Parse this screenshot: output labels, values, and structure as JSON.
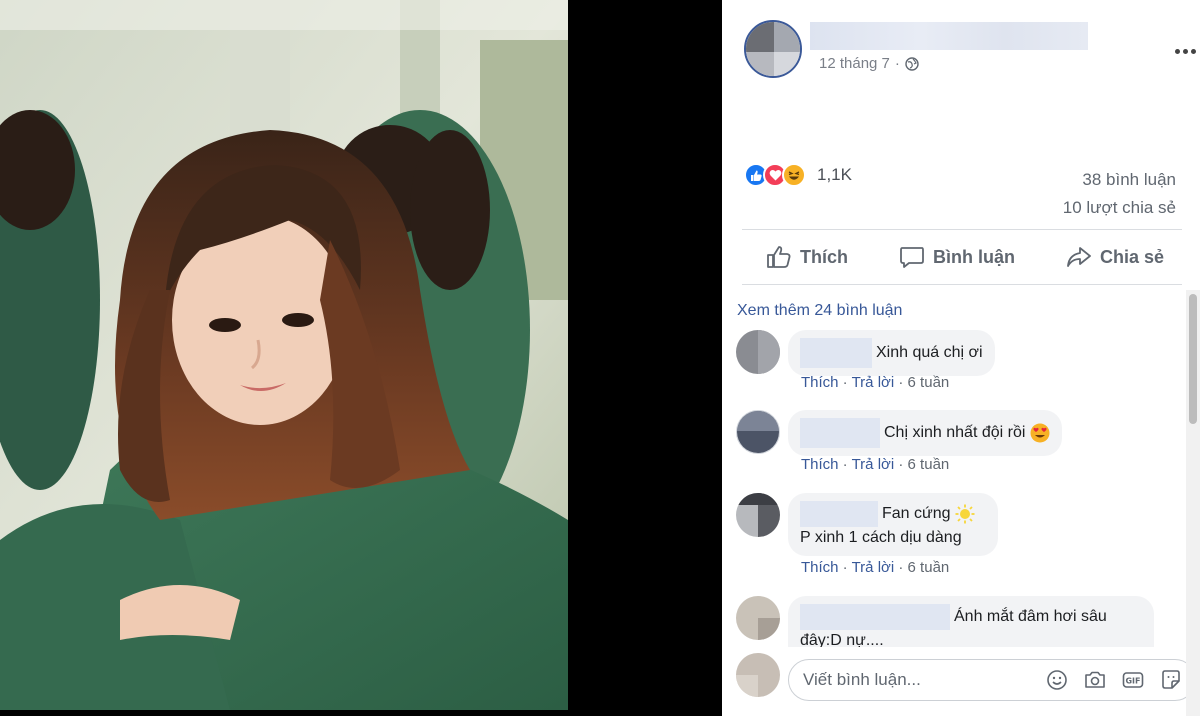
{
  "post": {
    "date": "12 tháng 7",
    "privacy_icon": "globe-icon",
    "more_icon": "more-options-icon"
  },
  "reactions": {
    "icons": [
      "like-icon",
      "love-icon",
      "haha-icon"
    ],
    "count": "1,1K",
    "comments_count": "38 bình luận",
    "shares_count": "10 lượt chia sẻ"
  },
  "actions": {
    "like": "Thích",
    "comment": "Bình luận",
    "share": "Chia sẻ"
  },
  "comments_section": {
    "see_more": "Xem thêm 24 bình luận",
    "items": [
      {
        "text": "Xinh quá chị ơi",
        "like": "Thích",
        "reply": "Trả lời",
        "time": "6 tuần"
      },
      {
        "text": "Chị xinh nhất đội rồi",
        "emoji": "heart-eyes-emoji",
        "like": "Thích",
        "reply": "Trả lời",
        "time": "6 tuần"
      },
      {
        "text": "Fan cứng",
        "text2": "P xinh 1 cách dịu dàng",
        "emoji": "sun-emoji",
        "like": "Thích",
        "reply": "Trả lời",
        "time": "6 tuần"
      },
      {
        "text": "Ánh mắt đâm hơi sâu",
        "text2": "đây:D nự...."
      }
    ]
  },
  "composer": {
    "placeholder": "Viết bình luận...",
    "tools": [
      "emoji-icon",
      "camera-icon",
      "gif-icon",
      "sticker-icon"
    ]
  },
  "colors": {
    "link": "#385898",
    "like_blue": "#1877f2",
    "love_red": "#f33e58",
    "haha_yellow": "#f7b125",
    "bubble": "#f2f3f5"
  }
}
